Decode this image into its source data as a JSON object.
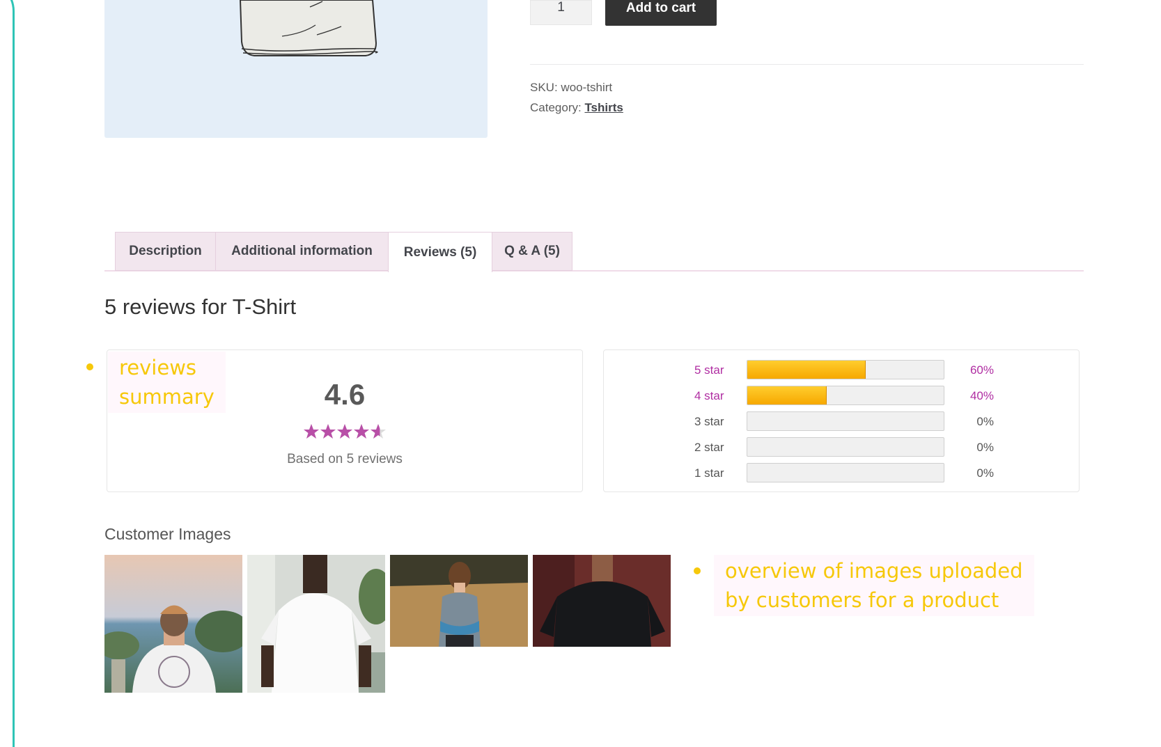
{
  "purchase": {
    "quantity": "1",
    "add_to_cart": "Add to cart"
  },
  "meta": {
    "sku_label": "SKU:",
    "sku": "woo-tshirt",
    "category_label": "Category:",
    "category": "Tshirts"
  },
  "tabs": [
    {
      "label": "Description",
      "active": false
    },
    {
      "label": "Additional information",
      "active": false
    },
    {
      "label": "Reviews (5)",
      "active": true
    },
    {
      "label": "Q & A (5)",
      "active": false
    }
  ],
  "reviews": {
    "title": "5 reviews for T-Shirt",
    "average": "4.6",
    "rating_value": 4.6,
    "rating_max": 5,
    "based_on": "Based on 5 reviews",
    "breakdown": [
      {
        "label": "5 star",
        "percent_text": "60%",
        "fraction": 0.6
      },
      {
        "label": "4 star",
        "percent_text": "40%",
        "fraction": 0.4
      },
      {
        "label": "3 star",
        "percent_text": "0%",
        "fraction": 0
      },
      {
        "label": "2 star",
        "percent_text": "0%",
        "fraction": 0
      },
      {
        "label": "1 star",
        "percent_text": "0%",
        "fraction": 0
      }
    ]
  },
  "customer_images": {
    "title": "Customer Images",
    "images": [
      {
        "name": "man-cap-white-tshirt-sea"
      },
      {
        "name": "man-white-tshirt"
      },
      {
        "name": "woman-grey-tshirt-field"
      },
      {
        "name": "man-black-tshirt"
      }
    ]
  },
  "callouts": {
    "summary": "reviews\nsummary",
    "images": "overview of images uploaded\nby customers for a product"
  },
  "colors": {
    "accent": "#b02ea2",
    "bar_fill": "#f6a800",
    "callout_text": "#f6c80a",
    "tab_bg": "#f2e6ee"
  }
}
